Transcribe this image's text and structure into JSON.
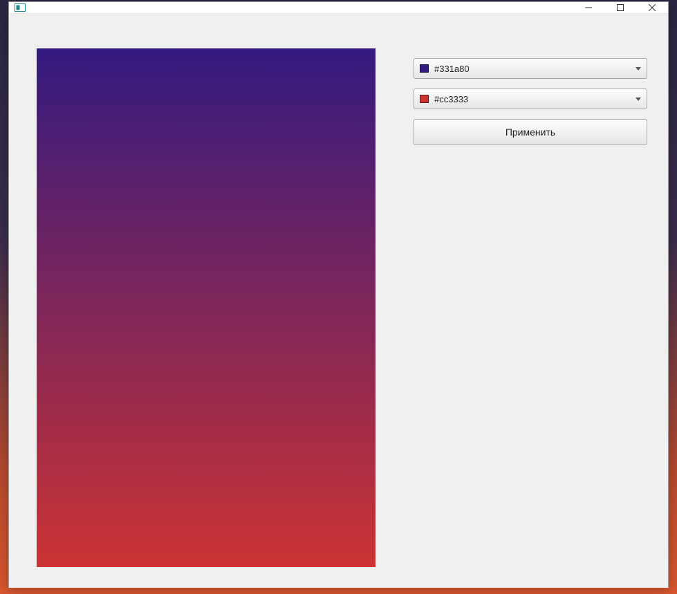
{
  "window": {
    "title": ""
  },
  "colors": {
    "top": {
      "label": "#331a80",
      "value": "#331a80"
    },
    "bottom": {
      "label": "#cc3333",
      "value": "#cc3333"
    }
  },
  "buttons": {
    "apply": "Применить"
  }
}
